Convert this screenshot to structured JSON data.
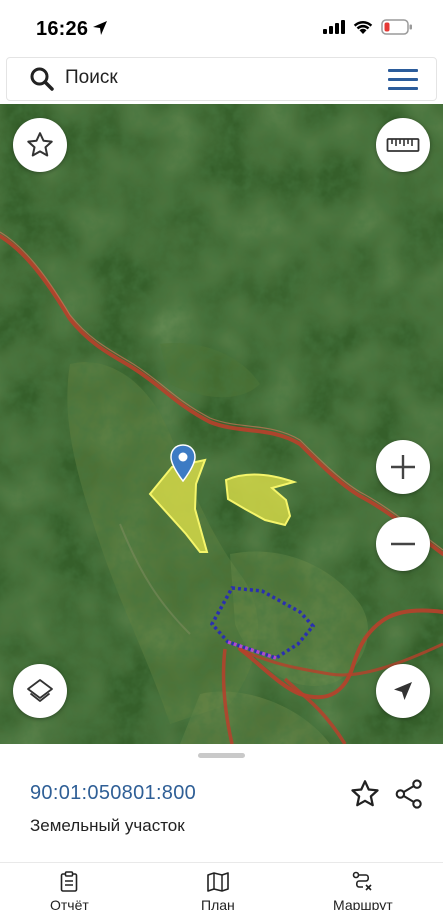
{
  "status": {
    "time": "16:26"
  },
  "search": {
    "placeholder": "Поиск"
  },
  "parcel": {
    "cadastral_number": "90:01:050801:800",
    "type": "Земельный участок"
  },
  "tabs": [
    {
      "label": "Отчёт",
      "icon": "clipboard-icon"
    },
    {
      "label": "План",
      "icon": "map-icon"
    },
    {
      "label": "Маршрут",
      "icon": "route-icon"
    }
  ],
  "colors": {
    "accent": "#2b5c9b",
    "parcel_fill": "#e6e64a",
    "road": "#c0392b",
    "boundary": "#2a2fb0"
  }
}
